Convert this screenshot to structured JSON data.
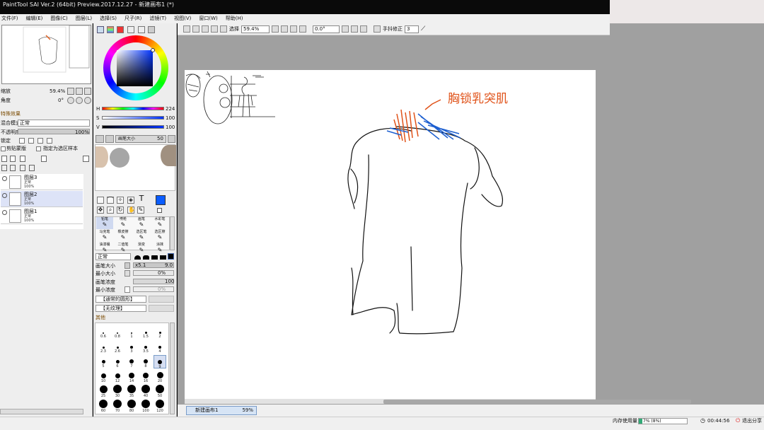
{
  "window": {
    "title": "PaintTool SAI Ver.2 (64bit) Preview.2017.12.27 - 新建画布1 (*)"
  },
  "menu": [
    "文件(F)",
    "编辑(E)",
    "图像(C)",
    "图层(L)",
    "选择(S)",
    "尺子(R)",
    "滤镜(T)",
    "视图(V)",
    "窗口(W)",
    "帮助(H)"
  ],
  "toolbar": {
    "select_label": "选择",
    "zoom": "59.4%",
    "rotation": "0.0°",
    "stabilizer_label": "手抖修正",
    "stabilizer_value": "3"
  },
  "navigator": {
    "zoom_label": "缩放",
    "zoom_value": "59.4%",
    "angle_label": "角度",
    "angle_value": "0°"
  },
  "layer_panel": {
    "effect_label": "特殊效果",
    "blend_label": "混合模式",
    "blend_value": "正常",
    "opacity_label": "不透明度",
    "opacity_value": "100%",
    "lock_label": "锁定",
    "clip_label": "剪贴蒙版",
    "select_source_label": "指定为选区样本",
    "layers": [
      {
        "name": "图层3",
        "mode": "正常",
        "opacity": "100%"
      },
      {
        "name": "图层2",
        "mode": "正常",
        "opacity": "100%"
      },
      {
        "name": "图层1",
        "mode": "正常",
        "opacity": "100%"
      }
    ]
  },
  "color_panel": {
    "h_label": "H",
    "h_value": "224",
    "s_label": "S",
    "s_value": "100",
    "v_label": "V",
    "v_value": "100",
    "brush_size_label": "画笔大小",
    "brush_size_value": "50",
    "primary_color": "#0a5cff"
  },
  "tools": {
    "groups": [
      "铅笔",
      "喷枪",
      "画笔",
      "水彩笔",
      "马克笔",
      "橡皮擦",
      "选区笔",
      "选区擦",
      "油漆桶",
      "二值笔",
      "渐变",
      "涂抹"
    ]
  },
  "brush_settings": {
    "mode": "正常",
    "size_label": "画笔大小",
    "size_multiplier": "x5.1",
    "size_value": "9.0",
    "min_size_label": "最小大小",
    "min_size_value": "0%",
    "density_label": "画笔浓度",
    "density_value": "100",
    "min_density_label": "最小浓度",
    "min_density_value": "0%",
    "shape_label": "【通常的圆形】",
    "texture_label": "【无纹理】",
    "other_label": "其他"
  },
  "brush_sizes": [
    "0.6",
    "0.8",
    "1",
    "1.5",
    "2",
    "2.3",
    "2.6",
    "3",
    "3.5",
    "4",
    "5",
    "6",
    "7",
    "8",
    "9",
    "10",
    "12",
    "14",
    "16",
    "20",
    "25",
    "30",
    "35",
    "40",
    "50",
    "60",
    "70",
    "80",
    "100",
    "120"
  ],
  "canvas": {
    "annotation_text": "胸锁乳突肌"
  },
  "document_tab": {
    "name": "新建画布1",
    "zoom": "59%"
  },
  "status": {
    "memory_label": "内存使用量",
    "memory_value": "7% (8%)",
    "timer": "00:44:56",
    "exit_share": "退出分享"
  }
}
